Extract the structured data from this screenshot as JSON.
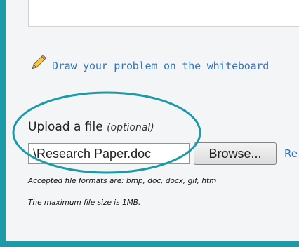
{
  "whiteboard_link": "Draw your problem on the whiteboard",
  "upload": {
    "label": "Upload a file",
    "optional": "(optional)",
    "file_value": "\\Research Paper.doc",
    "browse_label": "Browse...",
    "remove_partial": "Re"
  },
  "notes": {
    "formats": "Accepted file formats are: bmp, doc, docx, gif, htm",
    "max_size": "The maximum file size is 1MB."
  },
  "icons": {
    "pencil": "pencil-icon"
  },
  "colors": {
    "accent": "#1b9aa8",
    "link": "#2f74c1"
  }
}
